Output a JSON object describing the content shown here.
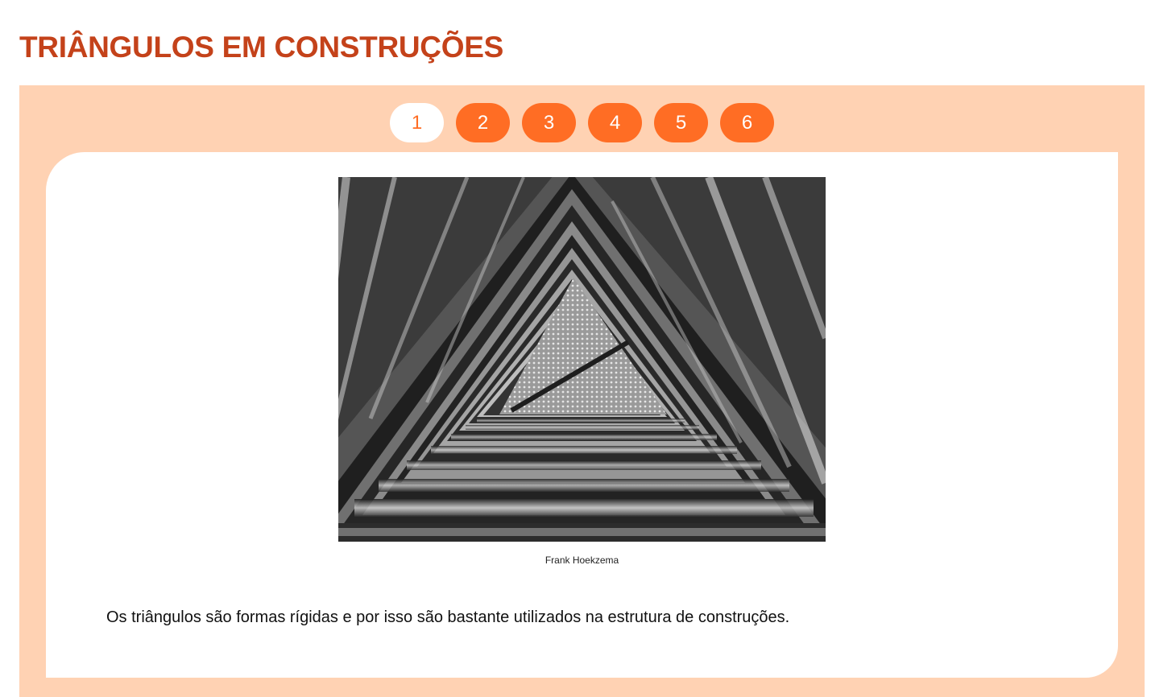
{
  "page": {
    "title": "TRIÂNGULOS EM CONSTRUÇÕES"
  },
  "pager": {
    "pages": [
      "1",
      "2",
      "3",
      "4",
      "5",
      "6"
    ],
    "active_index": 0
  },
  "content": {
    "image_alt": "triangular-steel-tunnel-photo",
    "credit": "Frank Hoekzema",
    "text": "Os triângulos são formas rígidas e por isso são bastante utilizados na estrutura de construções."
  },
  "colors": {
    "title": "#c4421a",
    "panel_bg": "#ffd2b3",
    "button": "#ff6d24",
    "button_active_bg": "#ffffff"
  }
}
